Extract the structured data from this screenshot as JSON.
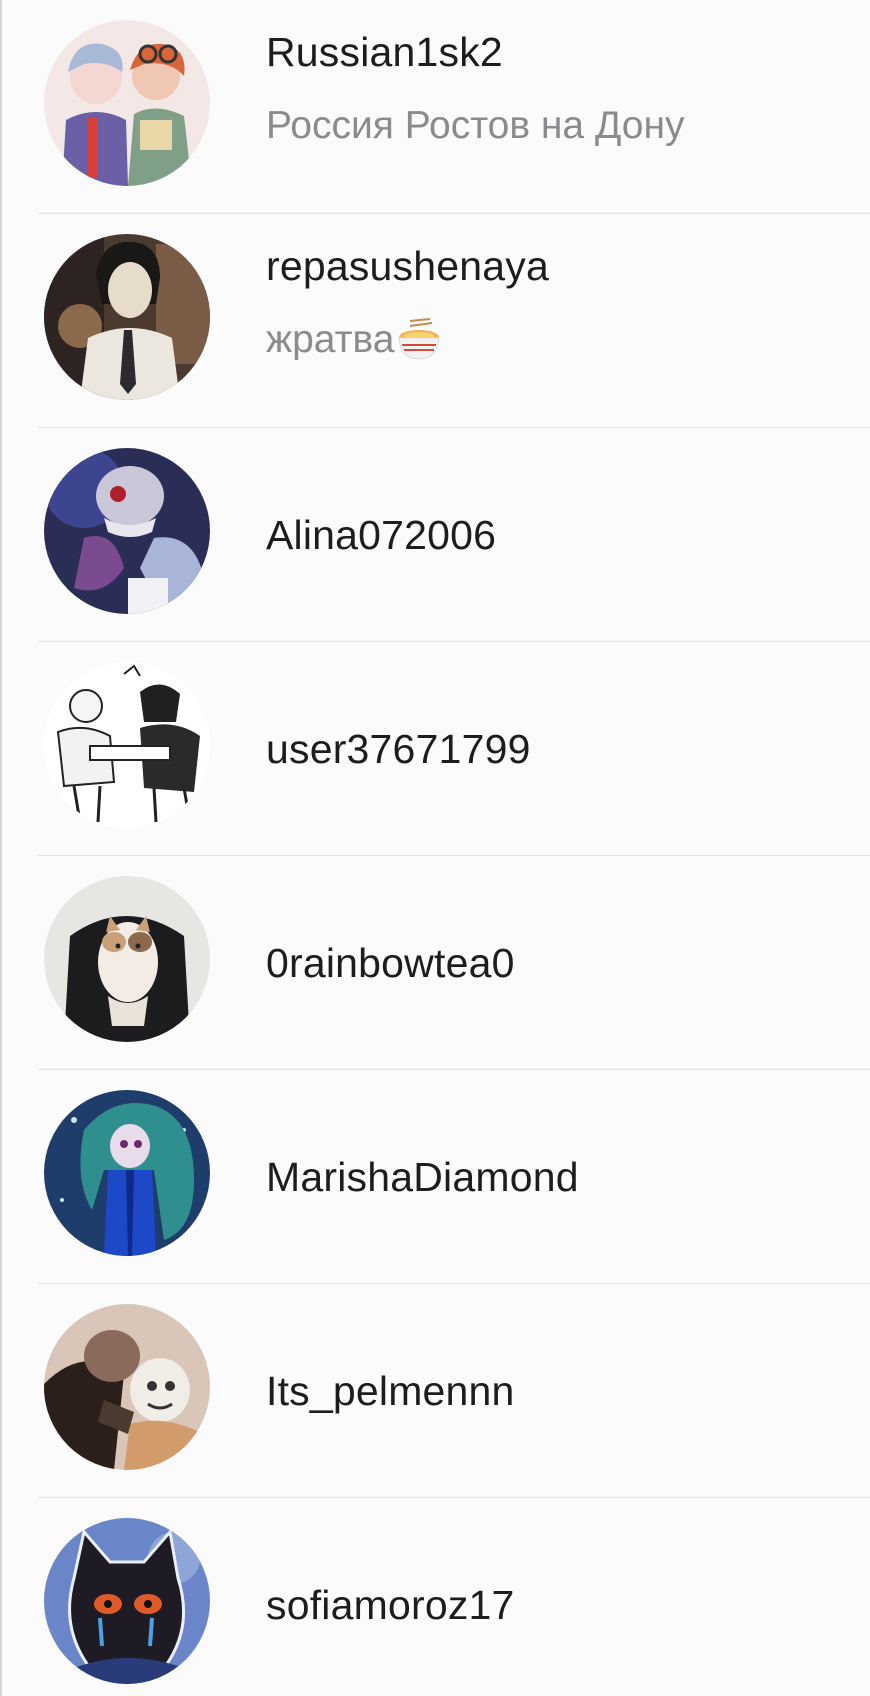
{
  "users": [
    {
      "username": "Russian1sk2",
      "bio": "Россия Ростов на Дону",
      "avatar_icon": "anime-duo-avatar",
      "avatar_colors": [
        "#f3d7d0",
        "#6b5fa8",
        "#d8663a"
      ]
    },
    {
      "username": "repasushenaya",
      "bio": "жратва",
      "bio_emoji_icon": "ramen-bowl-icon",
      "avatar_icon": "anime-man-tie-avatar",
      "avatar_colors": [
        "#3a2b24",
        "#e9e6de",
        "#1f1d22"
      ]
    },
    {
      "username": "Alina072006",
      "avatar_icon": "dark-skeleton-avatar",
      "avatar_colors": [
        "#2a2d55",
        "#c9c7d8",
        "#7a4b8f"
      ]
    },
    {
      "username": "user37671799",
      "avatar_icon": "manga-sketch-avatar",
      "avatar_colors": [
        "#ffffff",
        "#202020",
        "#9a9a9a"
      ]
    },
    {
      "username": "0rainbowtea0",
      "avatar_icon": "cat-photo-avatar",
      "avatar_colors": [
        "#e8e6e3",
        "#1c1c1e",
        "#c9a07a"
      ]
    },
    {
      "username": "MarishaDiamond",
      "avatar_icon": "blue-anime-girl-avatar",
      "avatar_colors": [
        "#1e3d6a",
        "#1d49c8",
        "#2f8f8f"
      ]
    },
    {
      "username": "Its_pelmennn",
      "avatar_icon": "anime-hug-avatar",
      "avatar_colors": [
        "#2b1f1c",
        "#d29b6b",
        "#8a6a5a"
      ]
    },
    {
      "username": "sofiamoroz17",
      "avatar_icon": "black-cat-avatar",
      "avatar_colors": [
        "#6a86c8",
        "#1f1b24",
        "#e05a2a"
      ]
    }
  ]
}
